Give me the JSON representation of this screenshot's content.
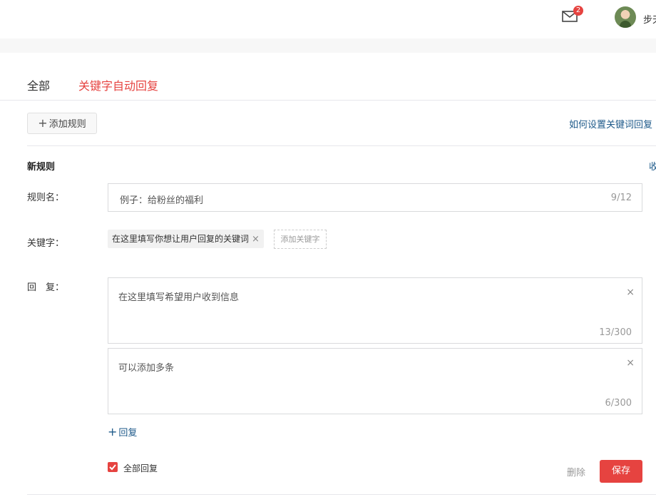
{
  "header": {
    "mail_badge": "2",
    "username": "步天"
  },
  "tabs": [
    {
      "label": "全部"
    },
    {
      "label": "关键字自动回复"
    }
  ],
  "toolbar": {
    "add_rule_label": "添加规则",
    "help_link": "如何设置关键词回复"
  },
  "rule": {
    "title": "新规则",
    "collapse_label": "收起",
    "name_label": "规则名：",
    "name_value": "例子：给粉丝的福利",
    "name_count": "9/12",
    "keyword_label": "关键字：",
    "keyword_tag": "在这里填写你想让用户回复的关键词",
    "keyword_add_placeholder": "添加关键字",
    "reply_label": "回　复：",
    "replies": [
      {
        "text": "在这里填写希望用户收到信息",
        "count": "13/300"
      },
      {
        "text": "可以添加多条",
        "count": "6/300"
      }
    ],
    "add_reply_label": "回复",
    "reply_all_label": "全部回复",
    "reply_all_checked": true,
    "delete_label": "删除",
    "save_label": "保存"
  },
  "colors": {
    "accent": "#e64340",
    "link": "#1e5a8a"
  }
}
